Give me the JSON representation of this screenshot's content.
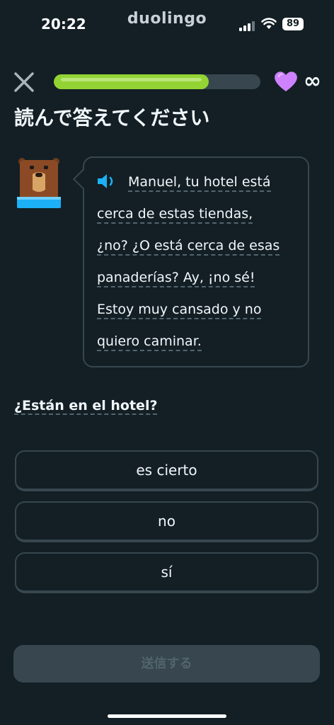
{
  "status_bar": {
    "time": "20:22",
    "brand": "duolingo",
    "battery": "89"
  },
  "header": {
    "progress": 0.75,
    "hearts": "∞"
  },
  "title": "読んで答えてください",
  "passage_lines": [
    "Manuel, tu hotel está",
    "cerca de estas tiendas,",
    "¿no? ¿O está cerca de esas",
    "panaderías? Ay, ¡no sé!",
    "Estoy muy cansado y no",
    "quiero caminar."
  ],
  "question": "¿Están en el hotel?",
  "options": [
    "es cierto",
    "no",
    "sí"
  ],
  "submit_label": "送信する",
  "colors": {
    "accent_green": "#93d333",
    "heart": "#ce82ff",
    "speaker": "#1cb0f6",
    "background": "#131f24",
    "border": "#37464f"
  },
  "icons": {
    "close": "close-icon",
    "heart": "heart-icon",
    "speaker": "speaker-icon"
  }
}
